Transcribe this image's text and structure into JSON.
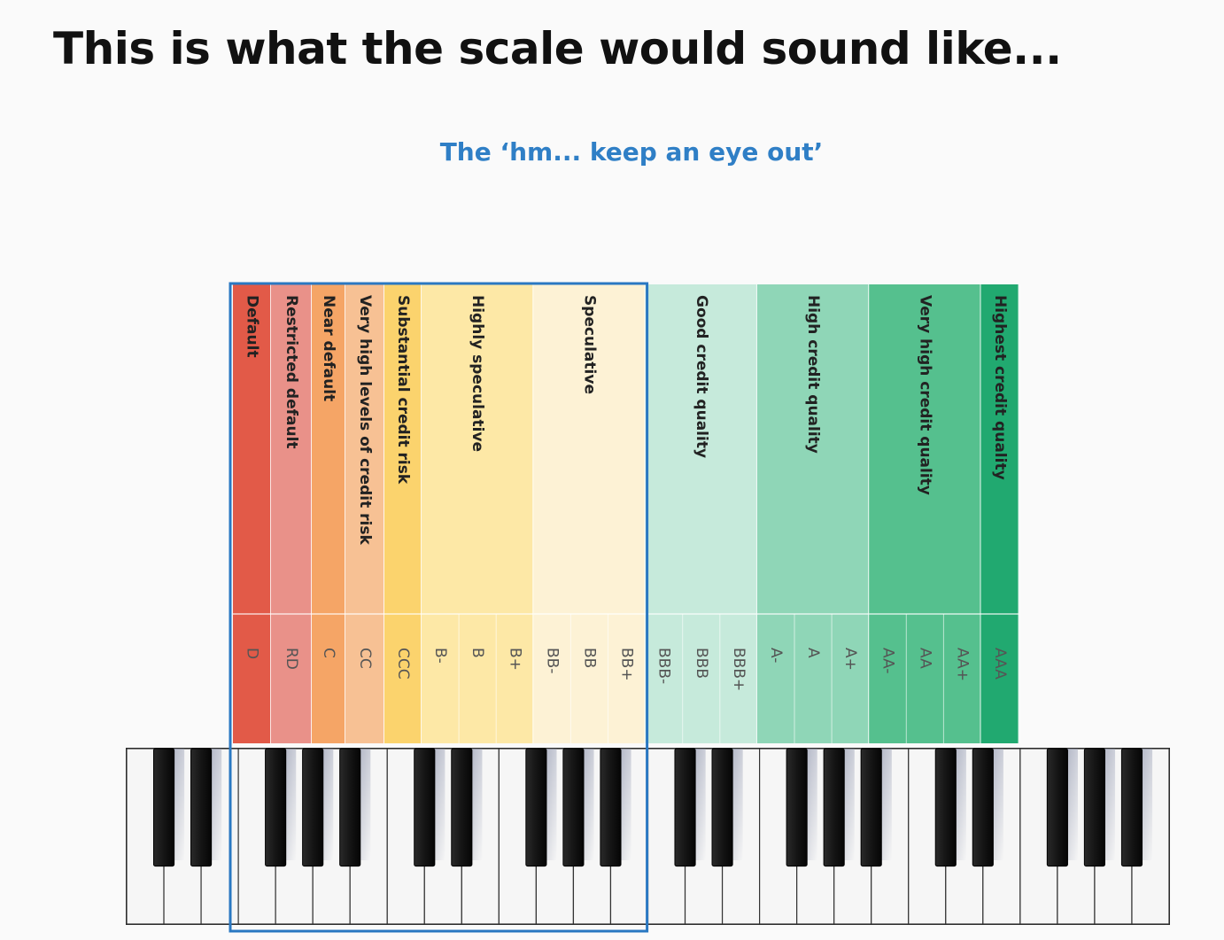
{
  "slide": {
    "title": "This is what the scale would sound like...",
    "subtitle": "The ‘hm... keep an eye out’"
  },
  "rating_scale": {
    "groups": [
      {
        "label": "Default",
        "ratings": [
          "D"
        ],
        "color": "#e25a48"
      },
      {
        "label": "Restricted default",
        "ratings": [
          "RD"
        ],
        "color": "#e99189"
      },
      {
        "label": "Near default",
        "ratings": [
          "C"
        ],
        "color": "#f5a566"
      },
      {
        "label": "Very high levels of credit risk",
        "ratings": [
          "CC"
        ],
        "color": "#f7c194"
      },
      {
        "label": "Substantial credit risk",
        "ratings": [
          "CCC"
        ],
        "color": "#fbd36d"
      },
      {
        "label": "Highly speculative",
        "ratings": [
          "B-",
          "B",
          "B+"
        ],
        "color": "#fde8a6"
      },
      {
        "label": "Speculative",
        "ratings": [
          "BB-",
          "BB",
          "BB+"
        ],
        "color": "#fdf2d5"
      },
      {
        "label": "Good credit quality",
        "ratings": [
          "BBB-",
          "BBB",
          "BBB+"
        ],
        "color": "#c6eadb"
      },
      {
        "label": "High credit quality",
        "ratings": [
          "A-",
          "A",
          "A+"
        ],
        "color": "#8fd6b7"
      },
      {
        "label": "Very high credit quality",
        "ratings": [
          "AA-",
          "AA",
          "AA+"
        ],
        "color": "#55c08e"
      },
      {
        "label": "Highest credit quality",
        "ratings": [
          "AAA"
        ],
        "color": "#21a970"
      }
    ],
    "highlight": {
      "from_rating": "D",
      "to_rating": "BB+",
      "color": "#2a78c2"
    }
  },
  "keyboard": {
    "white_key_color": "#f6f6f6",
    "black_key_color": "#151515"
  }
}
